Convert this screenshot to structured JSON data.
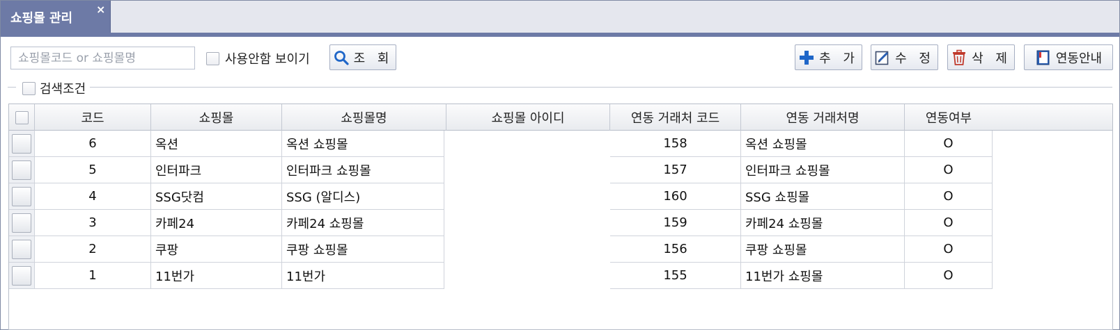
{
  "tab": {
    "title": "쇼핑몰 관리",
    "close": "×"
  },
  "toolbar": {
    "search_placeholder": "쇼핑몰코드 or 쇼핑몰명",
    "search_value": "",
    "show_unused_label": "사용안함 보이기",
    "search_button": "조 회",
    "add_button": "추 가",
    "edit_button": "수 정",
    "delete_button": "삭 제",
    "guide_button": "연동안내"
  },
  "condition": {
    "label": "검색조건"
  },
  "grid": {
    "columns": [
      "코드",
      "쇼핑몰",
      "쇼핑몰명",
      "쇼핑몰 아이디",
      "연동 거래처 코드",
      "연동 거래처명",
      "연동여부"
    ],
    "rows": [
      {
        "code": "6",
        "mall": "옥션",
        "mall_name": "옥션 쇼핑몰",
        "mall_id": "",
        "partner_code": "158",
        "partner_name": "옥션 쇼핑몰",
        "linked": "O"
      },
      {
        "code": "5",
        "mall": "인터파크",
        "mall_name": "인터파크 쇼핑몰",
        "mall_id": "",
        "partner_code": "157",
        "partner_name": "인터파크 쇼핑몰",
        "linked": "O"
      },
      {
        "code": "4",
        "mall": "SSG닷컴",
        "mall_name": "SSG (알디스)",
        "mall_id": "",
        "partner_code": "160",
        "partner_name": "SSG 쇼핑몰",
        "linked": "O"
      },
      {
        "code": "3",
        "mall": "카페24",
        "mall_name": "카페24 쇼핑몰",
        "mall_id": "",
        "partner_code": "159",
        "partner_name": "카페24 쇼핑몰",
        "linked": "O"
      },
      {
        "code": "2",
        "mall": "쿠팡",
        "mall_name": "쿠팡 쇼핑몰",
        "mall_id": "",
        "partner_code": "156",
        "partner_name": "쿠팡 쇼핑몰",
        "linked": "O"
      },
      {
        "code": "1",
        "mall": "11번가",
        "mall_name": "11번가",
        "mall_id": "",
        "partner_code": "155",
        "partner_name": "11번가 쇼핑몰",
        "linked": "O"
      }
    ]
  },
  "colors": {
    "tab_bg": "#6d7aa6",
    "accent_blue": "#1f66c8",
    "delete_red": "#c0392b"
  }
}
